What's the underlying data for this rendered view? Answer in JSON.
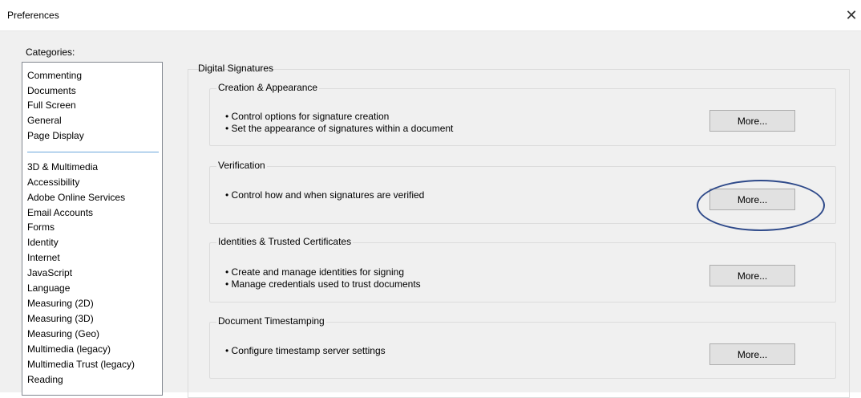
{
  "window": {
    "title": "Preferences",
    "close_glyph": "✕"
  },
  "categories": {
    "label": "Categories:",
    "group1": [
      "Commenting",
      "Documents",
      "Full Screen",
      "General",
      "Page Display"
    ],
    "group2": [
      "3D & Multimedia",
      "Accessibility",
      "Adobe Online Services",
      "Email Accounts",
      "Forms",
      "Identity",
      "Internet",
      "JavaScript",
      "Language",
      "Measuring (2D)",
      "Measuring (3D)",
      "Measuring (Geo)",
      "Multimedia (legacy)",
      "Multimedia Trust (legacy)",
      "Reading"
    ]
  },
  "panel": {
    "title": "Digital Signatures",
    "groups": [
      {
        "title": "Creation & Appearance",
        "bullets": [
          "• Control options for signature creation",
          "• Set the appearance of signatures within a document"
        ],
        "button": "More..."
      },
      {
        "title": "Verification",
        "bullets": [
          "• Control how and when signatures are verified"
        ],
        "button": "More..."
      },
      {
        "title": "Identities & Trusted Certificates",
        "bullets": [
          "• Create and manage identities for signing",
          "• Manage credentials used to trust documents"
        ],
        "button": "More..."
      },
      {
        "title": "Document Timestamping",
        "bullets": [
          "• Configure timestamp server settings"
        ],
        "button": "More..."
      }
    ]
  },
  "colors": {
    "dialog_bg": "#f0f0f0",
    "separator": "#6aa6dc",
    "highlight": "#2f4a8a"
  }
}
